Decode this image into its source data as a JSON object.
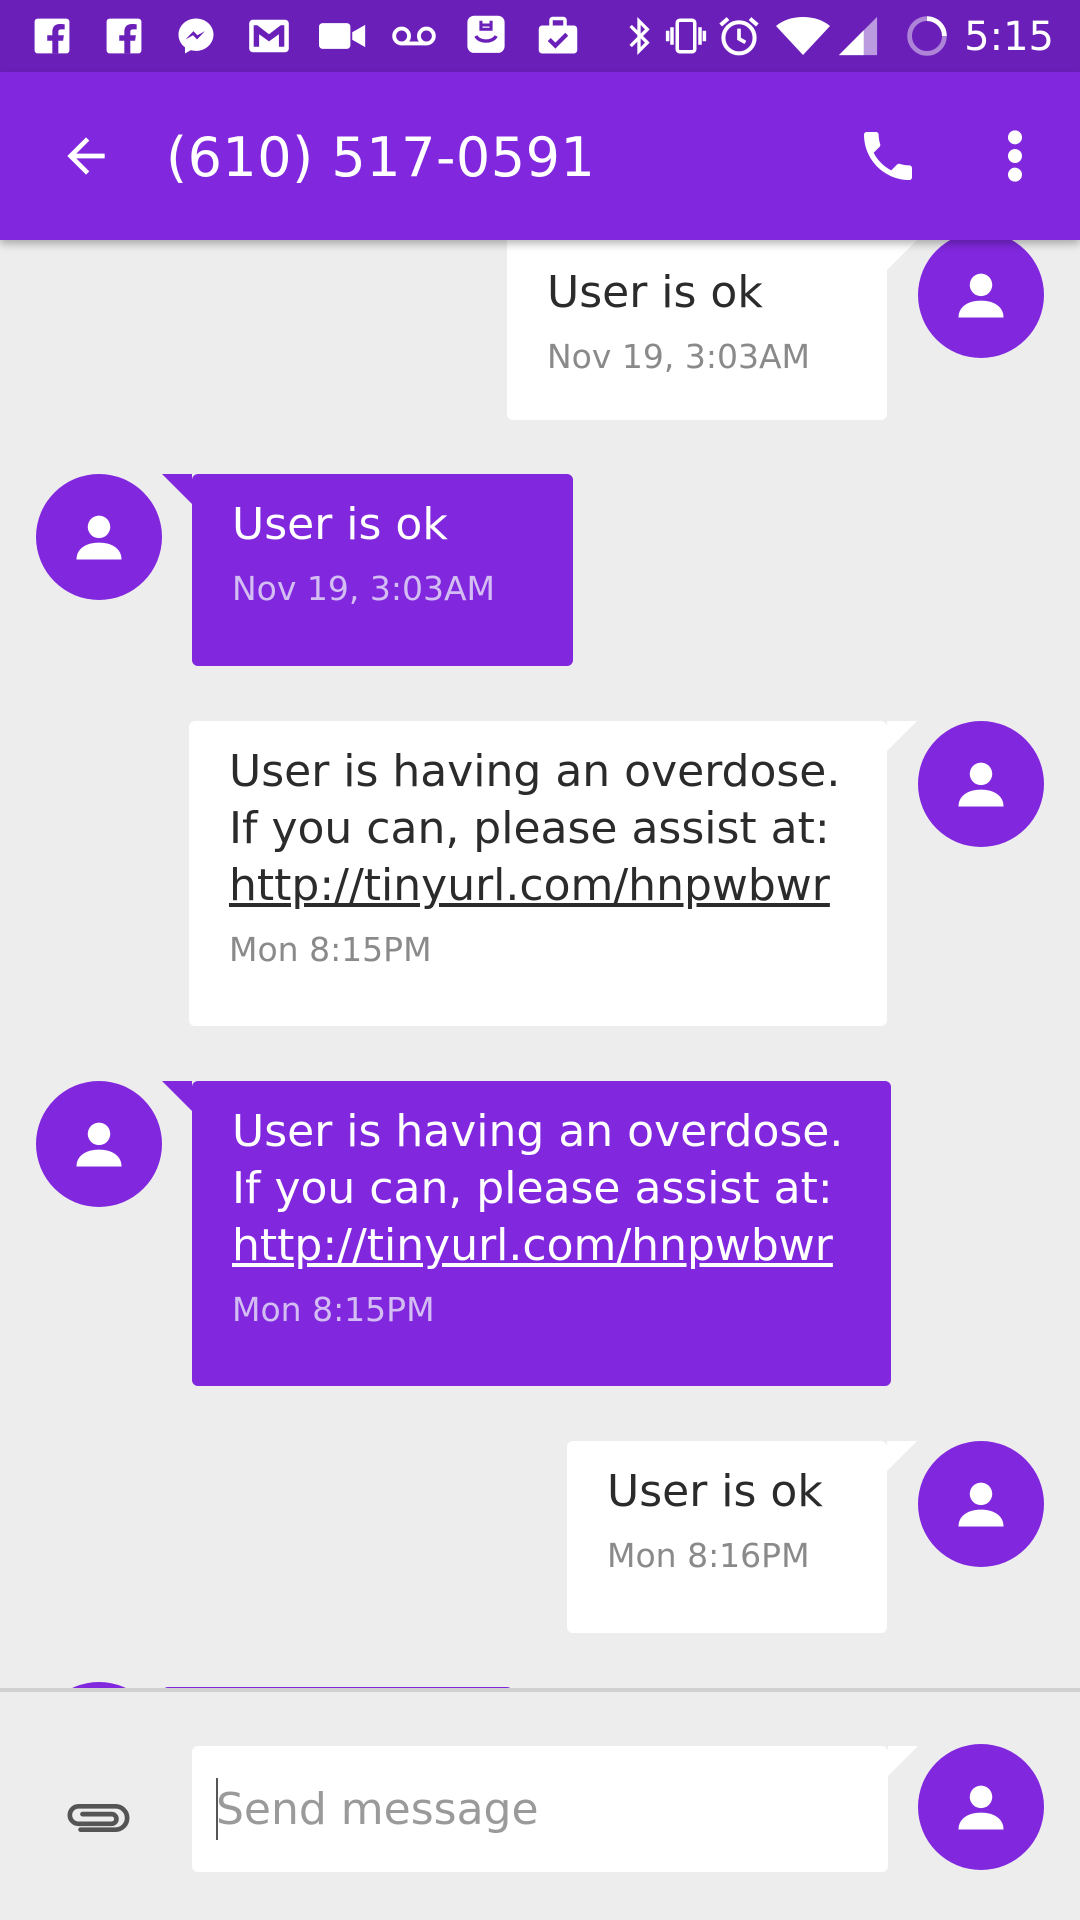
{
  "status_bar": {
    "time": "5:15",
    "left_icons": [
      "facebook-icon",
      "facebook-icon",
      "messenger-icon",
      "gmail-icon",
      "video-icon",
      "voicemail-icon",
      "app-icon",
      "briefcase-check-icon"
    ],
    "right_icons": [
      "bluetooth-icon",
      "vibrate-icon",
      "alarm-icon",
      "wifi-icon",
      "signal-icon",
      "sync-icon"
    ]
  },
  "header": {
    "title": "(610) 517-0591",
    "back_icon": "arrow-back-icon",
    "call_icon": "phone-icon",
    "more_icon": "more-vert-icon"
  },
  "messages": [
    {
      "direction": "incoming",
      "text": "User is ok",
      "link": "",
      "time": "Nov 19, 3:03AM"
    },
    {
      "direction": "outgoing",
      "text": "User is ok",
      "link": "",
      "time": "Nov 19, 3:03AM"
    },
    {
      "direction": "incoming",
      "text": "User is having an overdose.\nIf you can, please assist at:",
      "link": "http://tinyurl.com/hnpwbwr",
      "time": "Mon 8:15PM"
    },
    {
      "direction": "outgoing",
      "text": "User is having an overdose.\nIf you can, please assist at:",
      "link": "http://tinyurl.com/hnpwbwr",
      "time": "Mon 8:15PM"
    },
    {
      "direction": "incoming",
      "text": "User is ok",
      "link": "",
      "time": "Mon 8:16PM"
    }
  ],
  "compose": {
    "placeholder": "Send message",
    "value": "",
    "attach_icon": "paperclip-icon"
  },
  "colors": {
    "status_bar": "#6a1fb9",
    "accent": "#8128df",
    "incoming_bubble": "#ffffff",
    "background": "#ededed"
  }
}
